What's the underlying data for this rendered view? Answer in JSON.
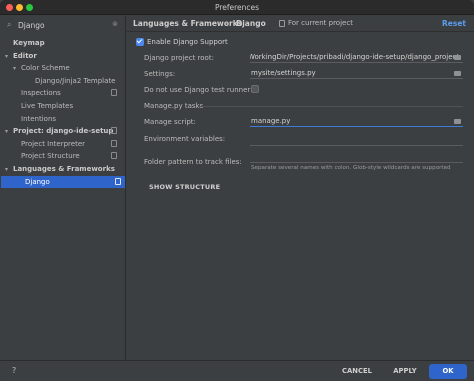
{
  "window": {
    "title": "Preferences"
  },
  "search": {
    "value": "Django"
  },
  "tree": [
    {
      "label": "Keymap",
      "bold": true,
      "level": 0,
      "arrow": "",
      "copy": false
    },
    {
      "label": "Editor",
      "bold": true,
      "level": 0,
      "arrow": "▾",
      "copy": false
    },
    {
      "label": "Color Scheme",
      "bold": false,
      "level": 1,
      "arrow": "▾",
      "copy": false
    },
    {
      "label": "Django/Jinja2 Template",
      "bold": false,
      "level": 2,
      "arrow": "",
      "copy": false
    },
    {
      "label": "Inspections",
      "bold": false,
      "level": 1,
      "arrow": "",
      "copy": true
    },
    {
      "label": "Live Templates",
      "bold": false,
      "level": 1,
      "arrow": "",
      "copy": false
    },
    {
      "label": "Intentions",
      "bold": false,
      "level": 1,
      "arrow": "",
      "copy": false
    },
    {
      "label": "Project: django-ide-setup",
      "bold": true,
      "level": 0,
      "arrow": "▾",
      "copy": true
    },
    {
      "label": "Project Interpreter",
      "bold": false,
      "level": 1,
      "arrow": "",
      "copy": true
    },
    {
      "label": "Project Structure",
      "bold": false,
      "level": 1,
      "arrow": "",
      "copy": true
    },
    {
      "label": "Languages & Frameworks",
      "bold": true,
      "level": 0,
      "arrow": "▾",
      "copy": false
    },
    {
      "label": "Django",
      "bold": false,
      "level": 1,
      "arrow": "",
      "copy": true,
      "selected": true
    }
  ],
  "breadcrumb": {
    "section": "Languages & Frameworks",
    "separator": "›",
    "page": "Django",
    "scope": "For current project",
    "reset": "Reset"
  },
  "form": {
    "enable_label": "Enable Django Support",
    "root_label": "Django project root:",
    "root_value": "WorkingDir/Projects/pribadi/django-ide-setup/django_project",
    "settings_label": "Settings:",
    "settings_value": "mysite/settings.py",
    "test_runner_label": "Do not use Django test runner:",
    "managepy_section": "Manage.py tasks",
    "manage_script_label": "Manage script:",
    "manage_script_value": "manage.py",
    "env_label": "Environment variables:",
    "env_value": "",
    "templates_label": "Folder pattern to track files:",
    "templates_value": "",
    "templates_hint": "Separate several names with colon. Glob-style wildcards are supported",
    "show_structure": "SHOW STRUCTURE"
  },
  "footer": {
    "help": "?",
    "cancel": "CANCEL",
    "apply": "APPLY",
    "ok": "OK"
  },
  "colors": {
    "accent": "#2f65ca",
    "link": "#5c9ded",
    "background": "#3c3f41"
  }
}
